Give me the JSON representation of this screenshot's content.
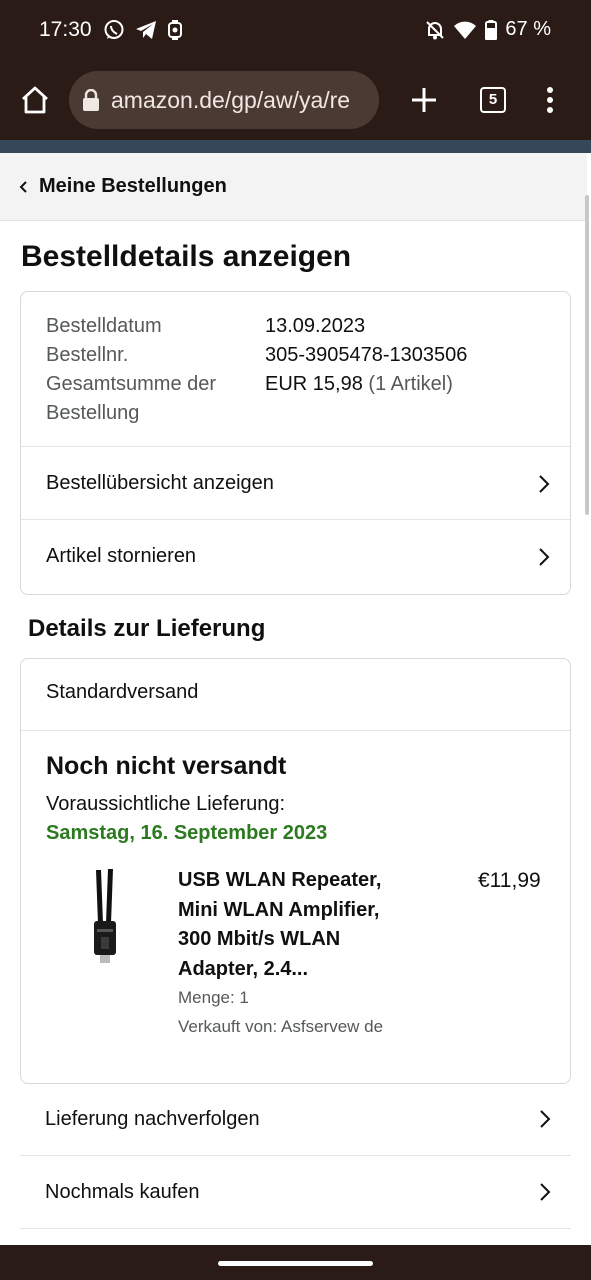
{
  "status_bar": {
    "time": "17:30",
    "battery": "67 %",
    "icons": [
      "whatsapp-icon",
      "telegram-icon",
      "app-notification-icon",
      "do-not-disturb-icon",
      "wifi-icon",
      "battery-icon"
    ]
  },
  "browser": {
    "url": "amazon.de/gp/aw/ya/re",
    "tab_count": "5",
    "icons": [
      "home-icon",
      "lock-icon",
      "plus-icon",
      "tabs-icon",
      "kebab-menu-icon"
    ]
  },
  "breadcrumb": {
    "label": "Meine Bestellungen"
  },
  "page": {
    "title": "Bestelldetails anzeigen"
  },
  "order_summary": {
    "rows": [
      {
        "label": "Bestelldatum",
        "value": "13.09.2023"
      },
      {
        "label": "Bestellnr.",
        "value": "305-3905478-1303506"
      },
      {
        "label": "Gesamtsumme der Bestellung",
        "value": "EUR 15,98",
        "value_note": "(1 Artikel)"
      }
    ],
    "links": [
      "Bestellübersicht anzeigen",
      "Artikel stornieren"
    ]
  },
  "delivery": {
    "heading": "Details zur Lieferung",
    "shipping_method": "Standardversand",
    "status": "Noch nicht versandt",
    "eta_label": "Voraussichtliche Lieferung:",
    "eta_date": "Samstag, 16. September 2023",
    "product": {
      "title": "USB WLAN Repeater, Mini WLAN Amplifier, 300 Mbit/s WLAN Adapter, 2.4...",
      "price": "€11,99",
      "quantity": "Menge: 1",
      "seller": "Verkauft von: Asfservew de"
    },
    "links": [
      "Lieferung nachverfolgen",
      "Nochmals kaufen"
    ]
  },
  "colors": {
    "system_bar": "#2a1b16",
    "url_bar": "#4a3a33",
    "nav_strip": "#37475a",
    "delivery_date": "#2b7a1f",
    "muted_text": "#565959",
    "border": "#d5d9d9"
  }
}
